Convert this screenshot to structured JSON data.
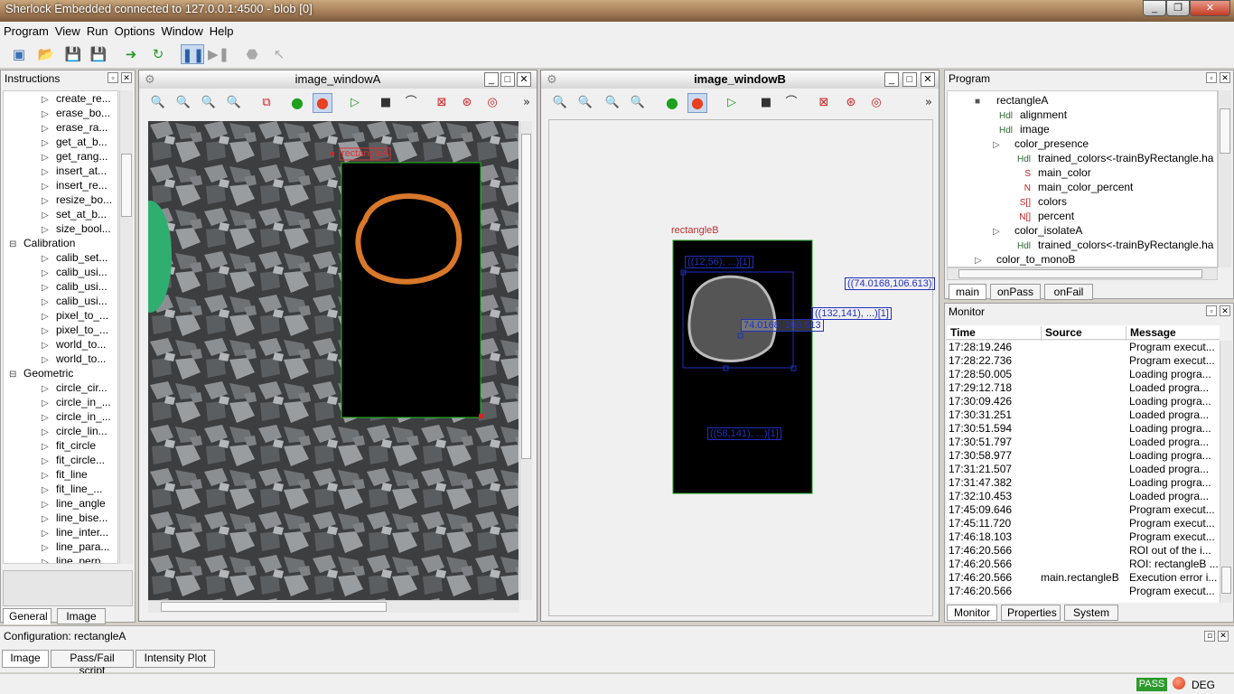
{
  "window_title": "Sherlock Embedded connected to 127.0.0.1:4500 - blob [0]",
  "menu": [
    "Program",
    "View",
    "Run",
    "Options",
    "Window",
    "Help"
  ],
  "instructions_panel": {
    "title": "Instructions",
    "items": [
      {
        "label": "create_re...",
        "level": 2
      },
      {
        "label": "erase_bo...",
        "level": 2
      },
      {
        "label": "erase_ra...",
        "level": 2
      },
      {
        "label": "get_at_b...",
        "level": 2
      },
      {
        "label": "get_rang...",
        "level": 2
      },
      {
        "label": "insert_at...",
        "level": 2
      },
      {
        "label": "insert_re...",
        "level": 2
      },
      {
        "label": "resize_bo...",
        "level": 2
      },
      {
        "label": "set_at_b...",
        "level": 2
      },
      {
        "label": "size_bool...",
        "level": 2
      },
      {
        "label": "Calibration",
        "level": 1
      },
      {
        "label": "calib_set...",
        "level": 2
      },
      {
        "label": "calib_usi...",
        "level": 2
      },
      {
        "label": "calib_usi...",
        "level": 2
      },
      {
        "label": "calib_usi...",
        "level": 2
      },
      {
        "label": "pixel_to_...",
        "level": 2
      },
      {
        "label": "pixel_to_...",
        "level": 2
      },
      {
        "label": "world_to...",
        "level": 2
      },
      {
        "label": "world_to...",
        "level": 2
      },
      {
        "label": "Geometric",
        "level": 1
      },
      {
        "label": "circle_cir...",
        "level": 2
      },
      {
        "label": "circle_in_...",
        "level": 2
      },
      {
        "label": "circle_in_...",
        "level": 2
      },
      {
        "label": "circle_lin...",
        "level": 2
      },
      {
        "label": "fit_circle",
        "level": 2
      },
      {
        "label": "fit_circle...",
        "level": 2
      },
      {
        "label": "fit_line",
        "level": 2
      },
      {
        "label": "fit_line_...",
        "level": 2
      },
      {
        "label": "line_angle",
        "level": 2
      },
      {
        "label": "line_bise...",
        "level": 2
      },
      {
        "label": "line_inter...",
        "level": 2
      },
      {
        "label": "line_para...",
        "level": 2
      },
      {
        "label": "line_perp...",
        "level": 2
      }
    ],
    "tabs": [
      "General",
      "Image"
    ]
  },
  "image_window_a": {
    "title": "image_windowA",
    "roi_label": "rectangleA"
  },
  "image_window_b": {
    "title": "image_windowB",
    "roi_label": "rectangleB",
    "annotations": [
      "((74.0168,106.613)",
      "((12,56), ...)[1]",
      "((132,141), ...)[1]",
      "74.0168, 106.613",
      "((58,141), ...)[1]"
    ]
  },
  "program_panel": {
    "title": "Program",
    "items": [
      {
        "label": "rectangleA",
        "level": 0,
        "tag": ""
      },
      {
        "label": "alignment",
        "level": 1,
        "tag": "Hdl"
      },
      {
        "label": "image",
        "level": 1,
        "tag": "Hdl"
      },
      {
        "label": "color_presence",
        "level": 1,
        "tag": ""
      },
      {
        "label": "trained_colors<-trainByRectangle.ha",
        "level": 2,
        "tag": "Hdl"
      },
      {
        "label": "main_color",
        "level": 2,
        "tag": "S"
      },
      {
        "label": "main_color_percent",
        "level": 2,
        "tag": "N"
      },
      {
        "label": "colors",
        "level": 2,
        "tag": "S[]"
      },
      {
        "label": "percent",
        "level": 2,
        "tag": "N[]"
      },
      {
        "label": "color_isolateA",
        "level": 1,
        "tag": ""
      },
      {
        "label": "trained_colors<-trainByRectangle.ha",
        "level": 2,
        "tag": "Hdl"
      },
      {
        "label": "color_to_monoB",
        "level": 0,
        "tag": ""
      }
    ],
    "tabs": [
      "main",
      "onPass",
      "onFail"
    ]
  },
  "monitor_panel": {
    "title": "Monitor",
    "columns": [
      "Time",
      "Source",
      "Message"
    ],
    "rows": [
      {
        "time": "17:28:19.246",
        "source": "",
        "message": "Program execut..."
      },
      {
        "time": "17:28:22.736",
        "source": "",
        "message": "Program execut..."
      },
      {
        "time": "17:28:50.005",
        "source": "",
        "message": "Loading progra..."
      },
      {
        "time": "17:29:12.718",
        "source": "",
        "message": "Loaded progra..."
      },
      {
        "time": "17:30:09.426",
        "source": "",
        "message": "Loading progra..."
      },
      {
        "time": "17:30:31.251",
        "source": "",
        "message": "Loaded progra..."
      },
      {
        "time": "17:30:51.594",
        "source": "",
        "message": "Loading progra..."
      },
      {
        "time": "17:30:51.797",
        "source": "",
        "message": "Loaded progra..."
      },
      {
        "time": "17:30:58.977",
        "source": "",
        "message": "Loading progra..."
      },
      {
        "time": "17:31:21.507",
        "source": "",
        "message": "Loaded progra..."
      },
      {
        "time": "17:31:47.382",
        "source": "",
        "message": "Loading progra..."
      },
      {
        "time": "17:32:10.453",
        "source": "",
        "message": "Loaded progra..."
      },
      {
        "time": "17:45:09.646",
        "source": "",
        "message": "Program execut..."
      },
      {
        "time": "17:45:11.720",
        "source": "",
        "message": "Program execut..."
      },
      {
        "time": "17:46:18.103",
        "source": "",
        "message": "Program execut..."
      },
      {
        "time": "17:46:20.566",
        "source": "",
        "message": "ROI out of the i..."
      },
      {
        "time": "17:46:20.566",
        "source": "",
        "message": "ROI: rectangleB ..."
      },
      {
        "time": "17:46:20.566",
        "source": "main.rectangleB",
        "message": "Execution error i..."
      },
      {
        "time": "17:46:20.566",
        "source": "",
        "message": "Program execut..."
      }
    ],
    "tabs": [
      "Monitor",
      "Properties",
      "System"
    ]
  },
  "configuration": {
    "title": "Configuration:  rectangleA",
    "tabs": [
      "Image",
      "Pass/Fail script",
      "Intensity Plot"
    ]
  },
  "status": {
    "pass": "PASS",
    "deg": "DEG"
  }
}
